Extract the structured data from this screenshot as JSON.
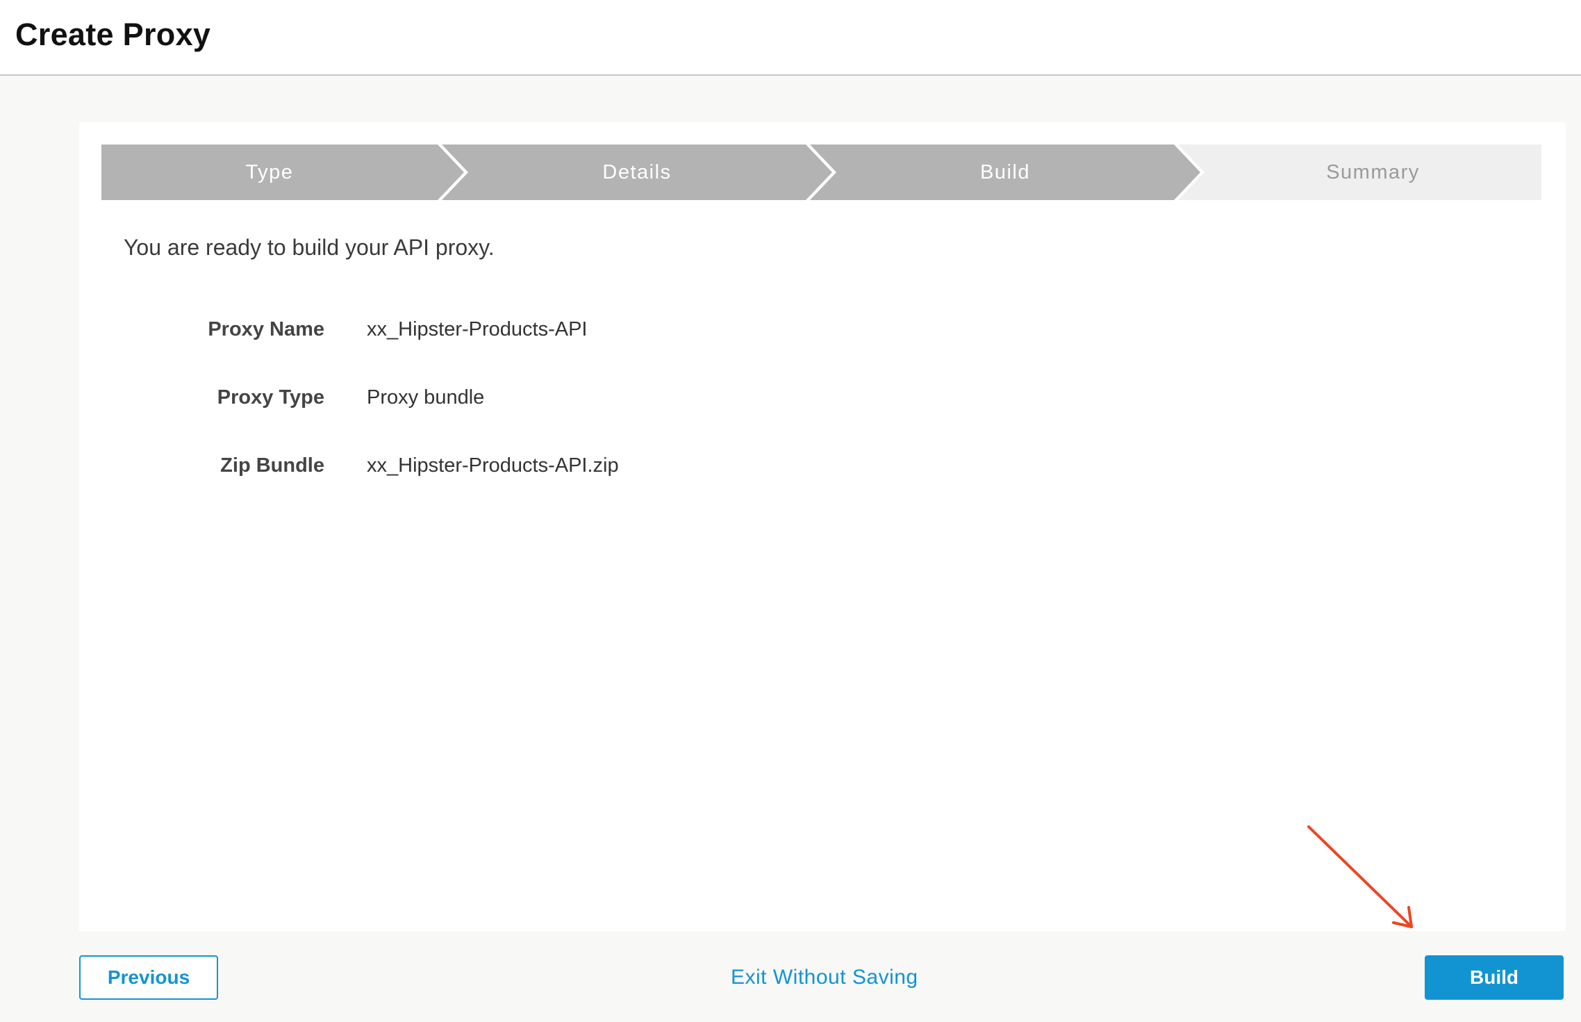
{
  "header": {
    "title": "Create Proxy"
  },
  "stepper": {
    "steps": [
      {
        "label": "Type",
        "state": "complete"
      },
      {
        "label": "Details",
        "state": "complete"
      },
      {
        "label": "Build",
        "state": "complete"
      },
      {
        "label": "Summary",
        "state": "upcoming"
      }
    ]
  },
  "main": {
    "intro": "You are ready to build your API proxy.",
    "summary": [
      {
        "label": "Proxy Name",
        "value": "xx_Hipster-Products-API"
      },
      {
        "label": "Proxy Type",
        "value": "Proxy bundle"
      },
      {
        "label": "Zip Bundle",
        "value": "xx_Hipster-Products-API.zip"
      }
    ]
  },
  "footer": {
    "previous_label": "Previous",
    "exit_label": "Exit Without Saving",
    "build_label": "Build"
  },
  "colors": {
    "accent": "#1394d2",
    "step_complete": "#b3b3b3",
    "step_upcoming": "#efefef",
    "annotation_arrow": "#ee4422"
  },
  "icons": {
    "annotation": "arrow-pointer-icon"
  }
}
